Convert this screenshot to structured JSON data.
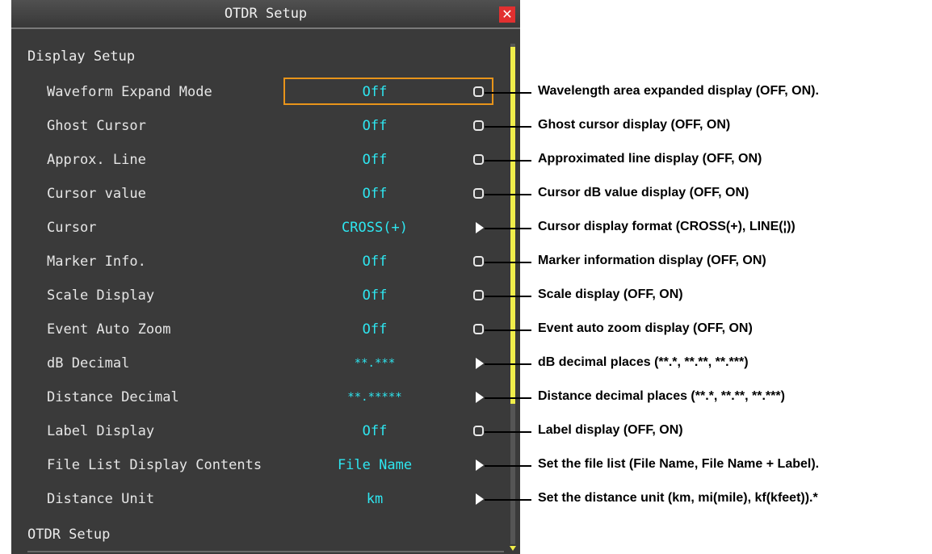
{
  "window": {
    "title": "OTDR Setup",
    "close_icon": "close-icon"
  },
  "sections": {
    "display": "Display Setup",
    "otdr": "OTDR Setup"
  },
  "rows": [
    {
      "label": "Waveform Expand Mode",
      "value": "Off",
      "control": "toggle",
      "selected": true,
      "annotation": "Wavelength area expanded display (OFF, ON)."
    },
    {
      "label": "Ghost Cursor",
      "value": "Off",
      "control": "toggle",
      "annotation": "Ghost cursor display (OFF, ON)"
    },
    {
      "label": "Approx. Line",
      "value": "Off",
      "control": "toggle",
      "annotation": "Approximated line display (OFF, ON)"
    },
    {
      "label": "Cursor value",
      "value": "Off",
      "control": "toggle",
      "annotation": "Cursor dB value display (OFF, ON)"
    },
    {
      "label": "Cursor",
      "value": "CROSS(+)",
      "control": "arrow",
      "annotation": "Cursor display format (CROSS(+), LINE(¦))"
    },
    {
      "label": "Marker Info.",
      "value": "Off",
      "control": "toggle",
      "annotation": "Marker information display (OFF, ON)"
    },
    {
      "label": "Scale Display",
      "value": "Off",
      "control": "toggle",
      "annotation": "Scale display (OFF, ON)"
    },
    {
      "label": "Event Auto Zoom",
      "value": "Off",
      "control": "toggle",
      "annotation": "Event auto zoom display (OFF, ON)"
    },
    {
      "label": "dB Decimal",
      "value": "**.***",
      "control": "arrow",
      "annotation": "dB decimal places (**.*, **.**, **.***)"
    },
    {
      "label": "Distance Decimal",
      "value": "**.*****",
      "control": "arrow",
      "annotation": "Distance decimal places (**.*, **.**, **.***)"
    },
    {
      "label": "Label Display",
      "value": "Off",
      "control": "toggle",
      "annotation": "Label display (OFF, ON)"
    },
    {
      "label": "File List Display Contents",
      "value": "File Name",
      "control": "arrow",
      "annotation": "Set the file list (File Name, File Name + Label)."
    },
    {
      "label": "Distance Unit",
      "value": "km",
      "control": "arrow",
      "annotation": "Set the distance unit (km, mi(mile), kf(kfeet)).*"
    }
  ],
  "colors": {
    "panel_bg": "#3a3a3a",
    "value_text": "#2ee6f0",
    "selection": "#e8941a",
    "scrollbar": "#f0ee4a",
    "close_bg": "#e23030"
  }
}
